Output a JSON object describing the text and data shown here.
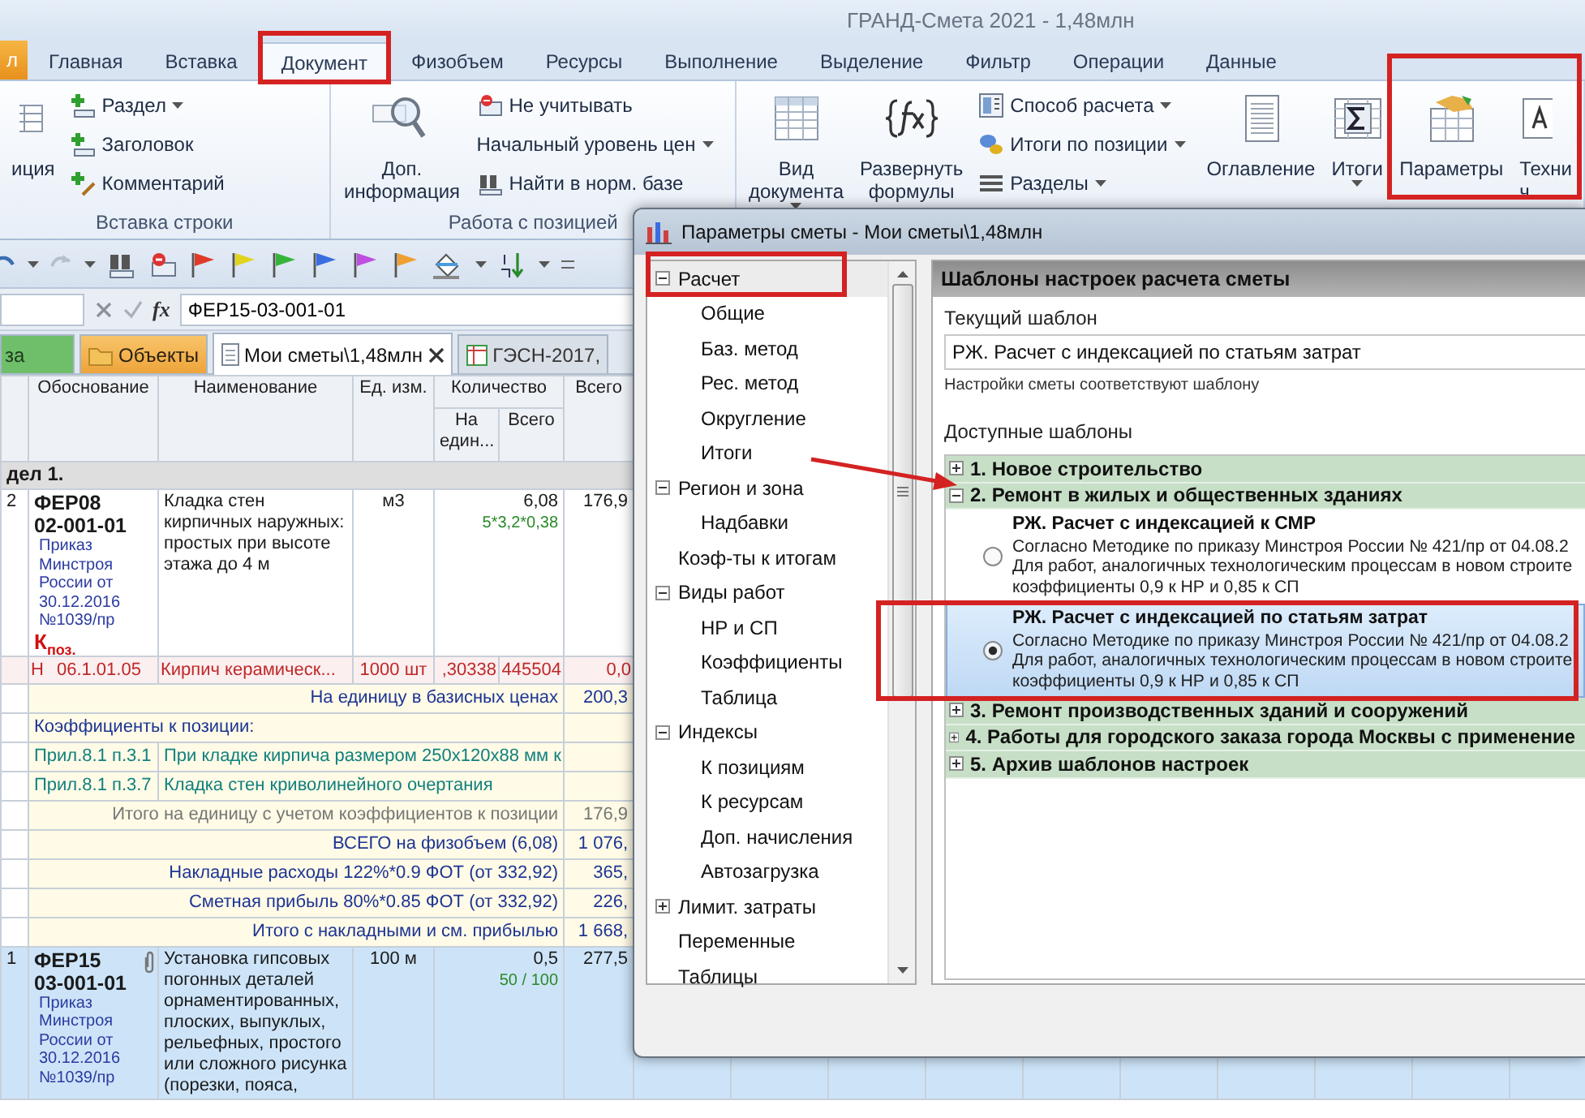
{
  "window": {
    "title": "ГРАНД-Смета 2021 - 1,48млн"
  },
  "ribbon": {
    "tabs": [
      {
        "label": "л",
        "kind": "file",
        "selected": false
      },
      {
        "label": "Главная",
        "kind": "tab",
        "selected": false
      },
      {
        "label": "Вставка",
        "kind": "tab",
        "selected": false
      },
      {
        "label": "Документ",
        "kind": "tab",
        "selected": true
      },
      {
        "label": "Физобъем",
        "kind": "tab",
        "selected": false
      },
      {
        "label": "Ресурсы",
        "kind": "tab",
        "selected": false
      },
      {
        "label": "Выполнение",
        "kind": "tab",
        "selected": false
      },
      {
        "label": "Выделение",
        "kind": "tab",
        "selected": false
      },
      {
        "label": "Фильтр",
        "kind": "tab",
        "selected": false
      },
      {
        "label": "Операции",
        "kind": "tab",
        "selected": false
      },
      {
        "label": "Данные",
        "kind": "tab",
        "selected": false
      }
    ],
    "groups": [
      {
        "label": "Вставка строки",
        "buttons": [
          {
            "kind": "large",
            "label": "иция"
          },
          {
            "kind": "small",
            "label": "Раздел",
            "dropdown": true
          },
          {
            "kind": "small",
            "label": "Заголовок"
          },
          {
            "kind": "small",
            "label": "Комментарий"
          }
        ]
      },
      {
        "label": "Работа с позицией",
        "buttons": [
          {
            "kind": "large",
            "label": "Доп. информация"
          },
          {
            "kind": "small",
            "label": "Не учитывать"
          },
          {
            "kind": "small",
            "label": "Начальный уровень цен",
            "dropdown": true
          },
          {
            "kind": "small",
            "label": "Найти в норм. базе"
          }
        ]
      },
      {
        "buttons": [
          {
            "kind": "large",
            "label": "Вид документа",
            "dropdown": true
          },
          {
            "kind": "large",
            "label": "Развернуть формулы"
          },
          {
            "kind": "small",
            "label": "Способ расчета",
            "dropdown": true
          },
          {
            "kind": "small",
            "label": "Итоги по позиции",
            "dropdown": true
          },
          {
            "kind": "small",
            "label": "Разделы",
            "dropdown": true
          }
        ]
      },
      {
        "buttons": [
          {
            "kind": "large",
            "label": "Оглавление"
          },
          {
            "kind": "large",
            "label": "Итоги",
            "dropdown": true
          },
          {
            "kind": "large",
            "label": "Параметры"
          },
          {
            "kind": "large",
            "label": "Техни ч"
          }
        ]
      }
    ]
  },
  "quick_toolbar": {
    "flags": [
      {
        "color": "#e03a2a"
      },
      {
        "color": "#e2d41c"
      },
      {
        "color": "#36b43a"
      },
      {
        "color": "#3a6ee0"
      },
      {
        "color": "#c04ee0"
      },
      {
        "color": "#f0a030"
      }
    ]
  },
  "formula_bar": {
    "function_label": "fx",
    "value": "ФЕР15-03-001-01"
  },
  "document_tabs": [
    {
      "label": "за",
      "kind": "base",
      "selected": false
    },
    {
      "label": "Объекты",
      "kind": "objects",
      "selected": false
    },
    {
      "label": "Мои сметы\\1,48млн",
      "kind": "estimate",
      "selected": true,
      "closable": true
    },
    {
      "label": "ГЭСН-2017,",
      "kind": "reference",
      "selected": false
    }
  ],
  "table": {
    "columns": [
      {
        "label": "Обоснование"
      },
      {
        "label": "Наименование"
      },
      {
        "label": "Ед. изм."
      },
      {
        "label": "Количество",
        "subcolumns": [
          "На един...",
          "Всего"
        ]
      },
      {
        "label": "Всего"
      }
    ],
    "rows": [
      {
        "kind": "section",
        "text": "дел 1."
      },
      {
        "kind": "position",
        "number": "2",
        "code": "ФЕР08 02-001-01",
        "source": "Приказ Минстроя России от 30.12.2016 №1039/пр",
        "marker": "К$_{поз.}$",
        "name": "Кладка стен кирпичных наружных: простых при высоте этажа до 4 м",
        "unit": "м3",
        "quantity": "6,08",
        "formula": "5*3,2*0,38",
        "total": "176,9",
        "attachment": false,
        "selected": false
      },
      {
        "kind": "resource",
        "type": "Н",
        "code": "06.1.01.05",
        "name": "Кирпич керамическ...",
        "unit": "1000 шт",
        "per_unit": ",30338",
        "quantity": "445504",
        "total": "0,0"
      },
      {
        "kind": "summary",
        "text": "На единицу в базисных ценах",
        "value": "200,3"
      },
      {
        "kind": "coef_header",
        "text": "Коэффициенты к позиции:"
      },
      {
        "kind": "coef",
        "code": "Прил.8.1 п.3.1",
        "text": "При кладке кирпича размером 250х120х88 мм к"
      },
      {
        "kind": "coef",
        "code": "Прил.8.1 п.3.7",
        "text": "Кладка стен криволинейного очертания"
      },
      {
        "kind": "subtotal",
        "text": "Итого на единицу с учетом коэффициентов к позиции",
        "value": "176,9"
      },
      {
        "kind": "summary",
        "text": "ВСЕГО на физобъем (6,08)",
        "value": "1 076,"
      },
      {
        "kind": "summary",
        "text": "Накладные расходы 122%*0.9 ФОТ (от 332,92)",
        "value": "365,"
      },
      {
        "kind": "summary",
        "text": "Сметная прибыль 80%*0.85 ФОТ (от 332,92)",
        "value": "226,"
      },
      {
        "kind": "summary",
        "text": "Итого с накладными и см. прибылью",
        "value": "1 668,"
      },
      {
        "kind": "position",
        "number": "1",
        "code": "ФЕР15 03-001-01",
        "source": "Приказ Минстроя России от 30.12.2016 №1039/пр",
        "name": "Установка гипсовых погонных деталей орнаментированных, плоских, выпуклых, рельефных, простого или сложного рисунка (порезки, пояса,",
        "unit": "100 м",
        "quantity": "0,5",
        "formula": "50 / 100",
        "total": "277,5",
        "attachment": true,
        "selected": true
      }
    ]
  },
  "dialog": {
    "title": "Параметры сметы - Мои сметы\\1,48млн",
    "tree": [
      {
        "label": "Расчет",
        "expanded": true,
        "selected": true,
        "children": [
          {
            "label": "Общие",
            "selected": false
          },
          {
            "label": "Баз. метод",
            "selected": false
          },
          {
            "label": "Рес. метод",
            "selected": false
          },
          {
            "label": "Округление",
            "selected": false
          },
          {
            "label": "Итоги",
            "selected": false
          }
        ]
      },
      {
        "label": "Регион и зона",
        "expanded": true,
        "selected": false,
        "children": [
          {
            "label": "Надбавки",
            "selected": false
          }
        ]
      },
      {
        "label": "Коэф-ты к итогам",
        "selected": false
      },
      {
        "label": "Виды работ",
        "expanded": true,
        "selected": false,
        "children": [
          {
            "label": "НР и СП",
            "selected": false
          },
          {
            "label": "Коэффициенты",
            "selected": false
          },
          {
            "label": "Таблица",
            "selected": false
          }
        ]
      },
      {
        "label": "Индексы",
        "expanded": true,
        "selected": false,
        "children": [
          {
            "label": "К позициям",
            "selected": false
          },
          {
            "label": "К ресурсам",
            "selected": false
          },
          {
            "label": "Доп. начисления",
            "selected": false
          },
          {
            "label": "Автозагрузка",
            "selected": false
          }
        ]
      },
      {
        "label": "Лимит. затраты",
        "expanded": false,
        "selected": false
      },
      {
        "label": "Переменные",
        "selected": false
      },
      {
        "label": "Таблицы",
        "selected": false
      }
    ],
    "panel": {
      "header": "Шаблоны настроек расчета сметы",
      "current_label": "Текущий шаблон",
      "current_value": "РЖ. Расчет с индексацией по статьям затрат",
      "status": "Настройки сметы соответствуют шаблону",
      "available_label": "Доступные шаблоны",
      "groups": [
        {
          "title": "1. Новое строительство",
          "expanded": false
        },
        {
          "title": "2. Ремонт в жилых и общественных зданиях",
          "expanded": true,
          "templates": [
            {
              "title": "РЖ. Расчет с индексацией к СМР",
              "lines": [
                "Согласно Методике по приказу Минстроя России № 421/пр от 04.08.2",
                "Для работ, аналогичных технологическим процессам в новом строите",
                "коэффициенты 0,9 к НР и 0,85 к СП"
              ],
              "selected": false
            },
            {
              "title": "РЖ. Расчет с индексацией по статьям затрат",
              "lines": [
                "Согласно Методике по приказу Минстроя России № 421/пр от 04.08.2",
                "Для работ, аналогичных технологическим процессам в новом строите",
                "коэффициенты 0,9 к НР и 0,85 к СП"
              ],
              "selected": true
            }
          ]
        },
        {
          "title": "3. Ремонт производственных зданий и сооружений",
          "expanded": false
        },
        {
          "title": "4. Работы для городского заказа города Москвы с применение",
          "expanded": false
        },
        {
          "title": "5. Архив шаблонов настроек",
          "expanded": false
        }
      ]
    }
  }
}
